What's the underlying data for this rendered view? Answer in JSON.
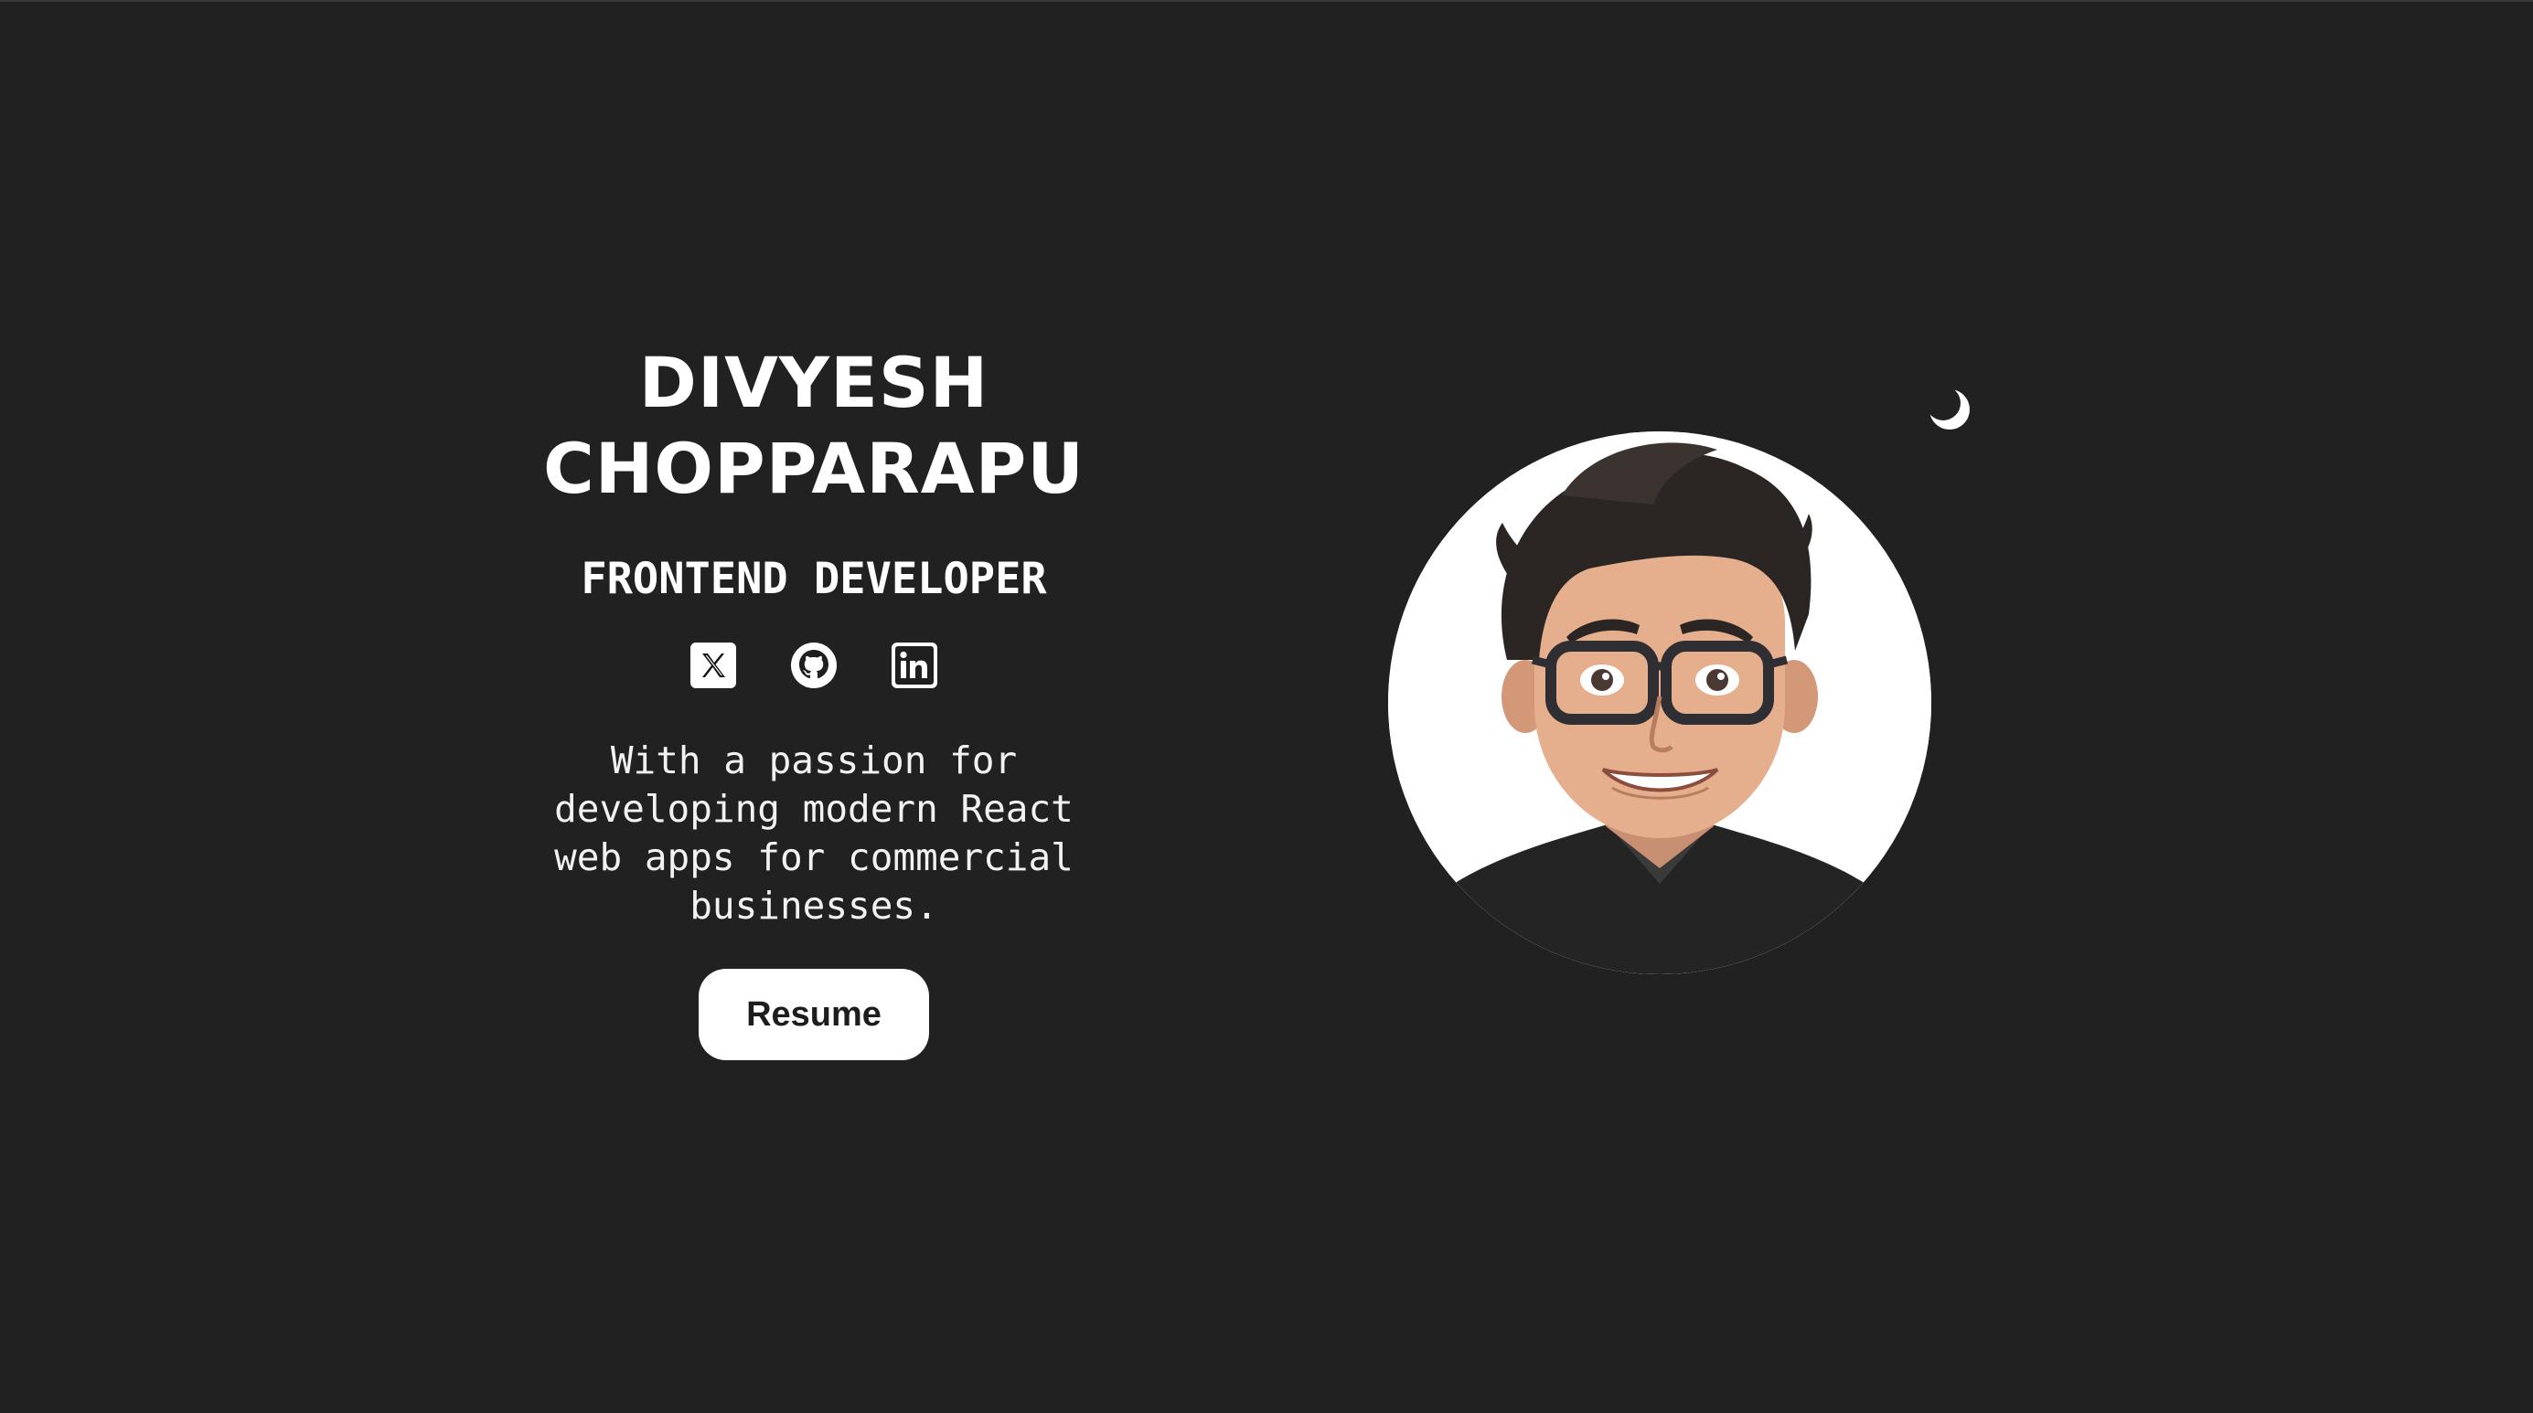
{
  "hero": {
    "name_line1": "DIVYESH",
    "name_line2": "CHOPPARAPU",
    "role": "FRONTEND DEVELOPER",
    "tagline": "With a passion for developing modern React web apps for commercial businesses.",
    "resume_label": "Resume"
  },
  "socials": [
    {
      "icon": "x-twitter-icon"
    },
    {
      "icon": "github-icon"
    },
    {
      "icon": "linkedin-icon"
    }
  ],
  "theme_toggle": {
    "icon": "moon-icon"
  },
  "avatar": {
    "icon": "avatar-illustration"
  },
  "colors": {
    "background": "#212121",
    "text": "#ffffff",
    "button_bg": "#ffffff",
    "button_text": "#1d1d1d"
  }
}
